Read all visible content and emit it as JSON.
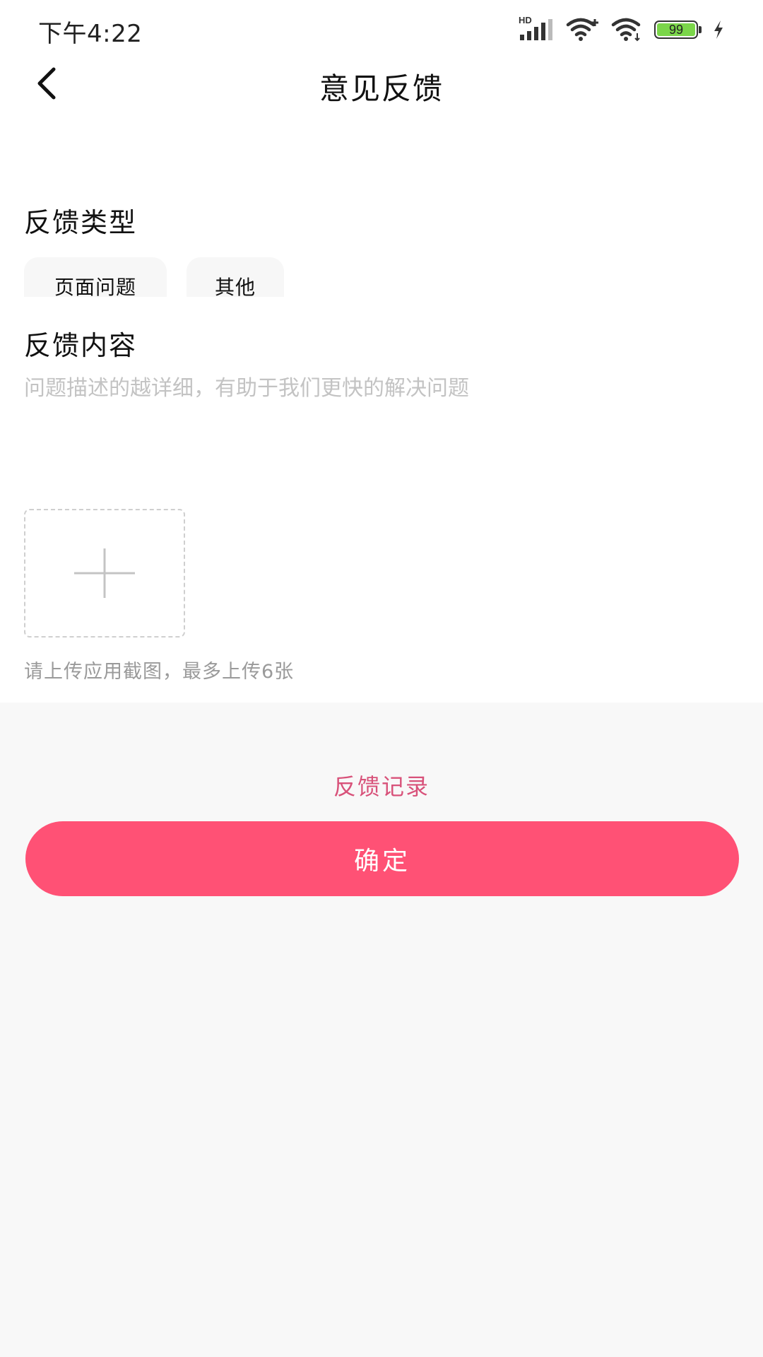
{
  "status_bar": {
    "time": "下午4:22",
    "signal_label": "HD",
    "battery_level": "99"
  },
  "header": {
    "title": "意见反馈"
  },
  "feedback_type": {
    "title": "反馈类型",
    "options": [
      {
        "label": "页面问题"
      },
      {
        "label": "其他"
      }
    ]
  },
  "feedback_content": {
    "title": "反馈内容",
    "placeholder": "问题描述的越详细，有助于我们更快的解决问题",
    "value": "",
    "upload_hint": "请上传应用截图，最多上传6张"
  },
  "actions": {
    "records_label": "反馈记录",
    "confirm_label": "确定"
  },
  "colors": {
    "accent": "#ff5175",
    "link": "#d8527a",
    "battery": "#7bd64a"
  },
  "icons": {
    "back": "chevron-left-icon",
    "upload": "plus-icon",
    "wifi": "wifi-icon",
    "signal": "signal-icon",
    "battery": "battery-icon",
    "charging": "lightning-icon"
  }
}
